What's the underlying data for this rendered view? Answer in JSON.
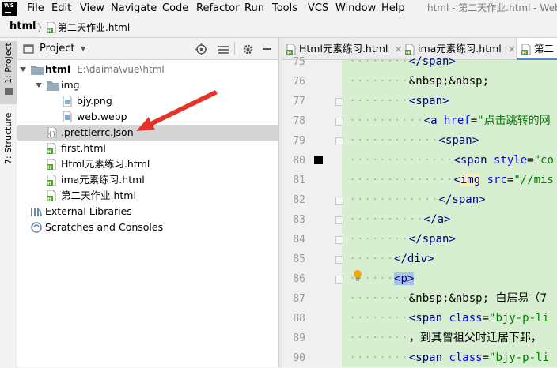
{
  "menubar": {
    "items": [
      "File",
      "Edit",
      "View",
      "Navigate",
      "Code",
      "Refactor",
      "Run",
      "Tools",
      "VCS",
      "Window",
      "Help"
    ],
    "window_title": "html - 第二天作业.html - Web"
  },
  "breadcrumb": {
    "root": "html",
    "file": "第二天作业.html"
  },
  "toolstripe": {
    "project_label": "1: Project",
    "structure_label": "7: Structure"
  },
  "project_panel": {
    "title": "Project",
    "dropdown_glyph": "▼",
    "tree": [
      {
        "label": "html",
        "hint": "E:\\daima\\vue\\html",
        "type": "folder",
        "level": 0,
        "expanded": true
      },
      {
        "label": "img",
        "type": "folder",
        "level": 1,
        "expanded": true
      },
      {
        "label": "bjy.png",
        "type": "image",
        "level": 2
      },
      {
        "label": "web.webp",
        "type": "image",
        "level": 2
      },
      {
        "label": ".prettierrc.json",
        "type": "json",
        "level": 1,
        "selected": true
      },
      {
        "label": "first.html",
        "type": "html",
        "level": 1
      },
      {
        "label": "Html元素练习.html",
        "type": "html",
        "level": 1
      },
      {
        "label": "ima元素练习.html",
        "type": "html",
        "level": 1
      },
      {
        "label": "第二天作业.html",
        "type": "html",
        "level": 1
      },
      {
        "label": "External Libraries",
        "type": "library",
        "level": 0
      },
      {
        "label": "Scratches and Consoles",
        "type": "scratch",
        "level": 0
      }
    ]
  },
  "tabs": [
    {
      "label": "Html元素练习.html",
      "active": false
    },
    {
      "label": "ima元素练习.html",
      "active": false
    },
    {
      "label": "第二",
      "active": true
    }
  ],
  "tab_close_glyph": "×",
  "editor": {
    "lines": [
      {
        "num": "75",
        "indent": 3,
        "parts": [
          {
            "c": "tag",
            "t": "</span>"
          }
        ]
      },
      {
        "num": "76",
        "indent": 3,
        "parts": [
          {
            "c": "txt",
            "t": "&nbsp;&nbsp;"
          }
        ]
      },
      {
        "num": "77",
        "indent": 3,
        "parts": [
          {
            "c": "tag",
            "t": "<span>"
          }
        ]
      },
      {
        "num": "78",
        "indent": 4,
        "parts": [
          {
            "c": "tag",
            "t": "<a "
          },
          {
            "c": "attr",
            "t": "href"
          },
          {
            "c": "txt",
            "t": "="
          },
          {
            "c": "attrval",
            "t": "\"点击跳转的网"
          }
        ]
      },
      {
        "num": "79",
        "indent": 5,
        "parts": [
          {
            "c": "tag",
            "t": "<span>"
          }
        ]
      },
      {
        "num": "80",
        "indent": 6,
        "parts": [
          {
            "c": "tag",
            "t": "<span "
          },
          {
            "c": "attr",
            "t": "style"
          },
          {
            "c": "txt",
            "t": "="
          },
          {
            "c": "attrval",
            "t": "\"co"
          }
        ]
      },
      {
        "num": "81",
        "indent": 6,
        "parts": [
          {
            "c": "tag",
            "t": "<"
          },
          {
            "c": "tag hl-img",
            "t": "img"
          },
          {
            "c": "tag",
            "t": " "
          },
          {
            "c": "attr",
            "t": "src"
          },
          {
            "c": "txt",
            "t": "="
          },
          {
            "c": "attrval",
            "t": "\"//mis"
          }
        ]
      },
      {
        "num": "82",
        "indent": 5,
        "parts": [
          {
            "c": "tag",
            "t": "</span>"
          }
        ]
      },
      {
        "num": "83",
        "indent": 4,
        "parts": [
          {
            "c": "tag",
            "t": "</a>"
          }
        ]
      },
      {
        "num": "84",
        "indent": 3,
        "parts": [
          {
            "c": "tag",
            "t": "</span>"
          }
        ]
      },
      {
        "num": "85",
        "indent": 2,
        "parts": [
          {
            "c": "tag",
            "t": "</div>"
          }
        ]
      },
      {
        "num": "86",
        "indent": 2,
        "parts": [
          {
            "c": "tag hl-tag",
            "t": "<p>"
          }
        ]
      },
      {
        "num": "87",
        "indent": 3,
        "parts": [
          {
            "c": "txt",
            "t": "&nbsp;&nbsp; "
          },
          {
            "c": "txt chinese",
            "t": "白居易（7"
          }
        ]
      },
      {
        "num": "88",
        "indent": 3,
        "parts": [
          {
            "c": "tag",
            "t": "<span "
          },
          {
            "c": "attr",
            "t": "class"
          },
          {
            "c": "txt",
            "t": "="
          },
          {
            "c": "attrval",
            "t": "\"bjy-p-li"
          }
        ]
      },
      {
        "num": "89",
        "indent": 3,
        "parts": [
          {
            "c": "txt chinese",
            "t": "，到其曾祖父时迁居下邽，"
          }
        ]
      },
      {
        "num": "90",
        "indent": 3,
        "parts": [
          {
            "c": "tag",
            "t": "<span "
          },
          {
            "c": "attr",
            "t": "class"
          },
          {
            "c": "txt",
            "t": "="
          },
          {
            "c": "attrval",
            "t": "\"bjy-p-li"
          }
        ]
      }
    ]
  },
  "colors": {
    "code_background": "#d8eed1",
    "accent_arrow": "#e5332a"
  }
}
